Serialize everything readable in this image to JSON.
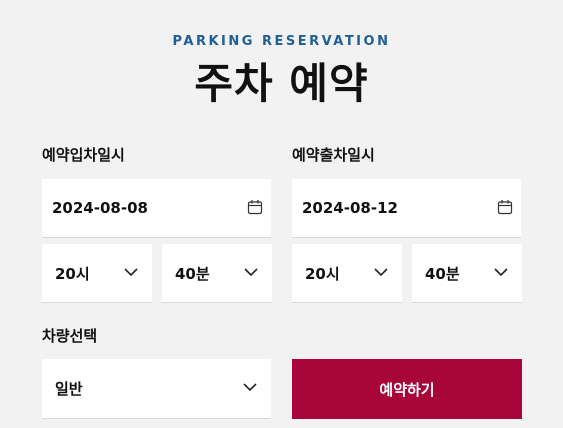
{
  "header": {
    "eyebrow": "PARKING RESERVATION",
    "title": "주차 예약"
  },
  "checkin": {
    "label": "예약입차일시",
    "date": "2024-08-08",
    "hour": "20시",
    "minute": "40분"
  },
  "checkout": {
    "label": "예약출차일시",
    "date": "2024-08-12",
    "hour": "20시",
    "minute": "40분"
  },
  "vehicle": {
    "label": "차량선택",
    "value": "일반"
  },
  "actions": {
    "reserve_label": "예약하기"
  },
  "colors": {
    "accent": "#a8063a",
    "eyebrow": "#1f5f98",
    "background": "#f2f2f2"
  },
  "icons": [
    "calendar-icon",
    "chevron-down-icon"
  ]
}
